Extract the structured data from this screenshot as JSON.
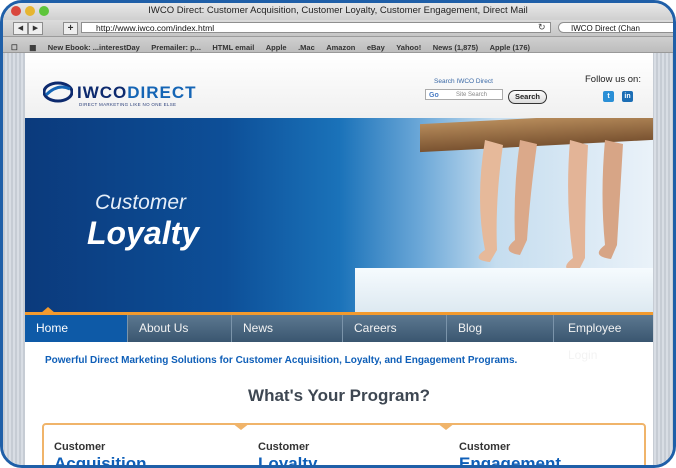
{
  "browser": {
    "window_title": "IWCO Direct: Customer Acquisition, Customer Loyalty, Customer Engagement, Direct Mail",
    "url": "http://www.iwco.com/index.html",
    "search_field": "IWCO Direct (Chan",
    "bookmarks": [
      "New Ebook: ...interestDay",
      "Premailer: p...",
      "HTML email",
      "Apple",
      ".Mac",
      "Amazon",
      "eBay",
      "Yahoo!",
      "News (1,875)",
      "Apple (176)"
    ]
  },
  "site": {
    "logo_main": "IWCO",
    "logo_accent": "DIRECT",
    "logo_tagline": "DIRECT MARKETING LIKE NO ONE ELSE",
    "search_label": "Search IWCO Direct",
    "search_placeholder": "Site Search",
    "search_button": "Search",
    "follow_label": "Follow us on:",
    "social": [
      "t",
      "in"
    ]
  },
  "hero": {
    "line1": "Customer",
    "line2": "Loyalty"
  },
  "nav": {
    "items": [
      "Home",
      "About Us",
      "News",
      "Careers",
      "Blog",
      "Employee Login"
    ],
    "active": "Home"
  },
  "intro_text": "Powerful Direct Marketing Solutions for Customer Acquisition, Loyalty, and Engagement Programs.",
  "program_heading": "What's Your Program?",
  "programs": [
    {
      "top": "Customer",
      "main": "Acquisition"
    },
    {
      "top": "Customer",
      "main": "Loyalty"
    },
    {
      "top": "Customer",
      "main": "Engagement"
    }
  ],
  "colors": {
    "brand_blue": "#0f5fb8",
    "nav_accent": "#f29a2e",
    "frame": "#1f5fa8"
  }
}
